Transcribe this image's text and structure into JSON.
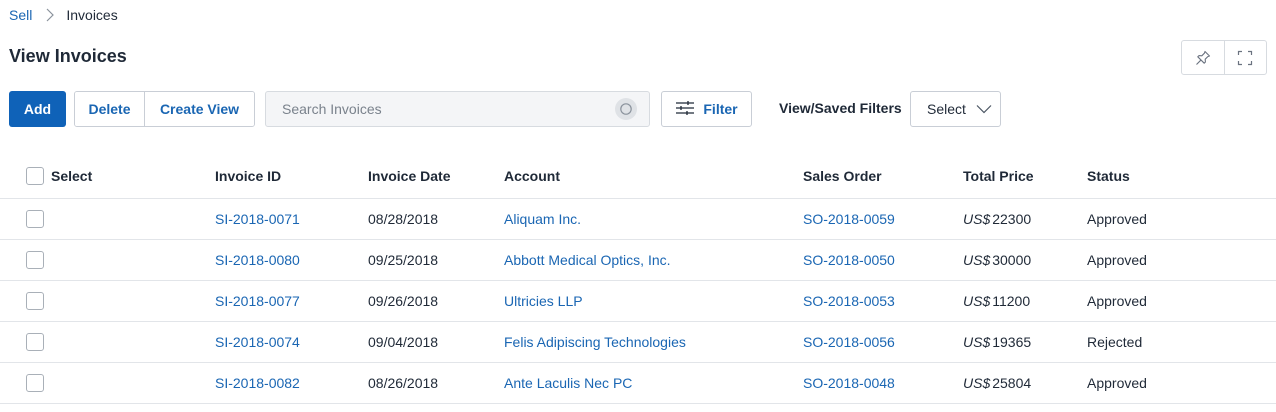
{
  "breadcrumb": {
    "parent": "Sell",
    "current": "Invoices"
  },
  "page": {
    "title": "View Invoices"
  },
  "toolbar": {
    "add_label": "Add",
    "delete_label": "Delete",
    "create_view_label": "Create View",
    "search_placeholder": "Search Invoices",
    "filter_label": "Filter",
    "saved_filters_label": "View/Saved Filters",
    "saved_filters_value": "Select"
  },
  "icons": {
    "breadcrumb_separator": "chevron-right-icon",
    "pin": "pin-icon",
    "expand": "fullscreen-icon",
    "search": "search-icon",
    "filter": "sliders-icon",
    "dropdown": "chevron-down-icon"
  },
  "colors": {
    "primary": "#0f62b8",
    "link": "#1a66b3",
    "border": "#e2e5e9"
  },
  "table": {
    "columns": {
      "select": "Select",
      "invoice_id": "Invoice ID",
      "invoice_date": "Invoice Date",
      "account": "Account",
      "sales_order": "Sales Order",
      "total_price": "Total Price",
      "status": "Status"
    },
    "rows": [
      {
        "invoice_id": "SI-2018-0071",
        "invoice_date": "08/28/2018",
        "account": "Aliquam Inc.",
        "sales_order": "SO-2018-0059",
        "currency": "US$",
        "amount": "22300",
        "status": "Approved"
      },
      {
        "invoice_id": "SI-2018-0080",
        "invoice_date": "09/25/2018",
        "account": "Abbott Medical Optics, Inc.",
        "sales_order": "SO-2018-0050",
        "currency": "US$",
        "amount": "30000",
        "status": "Approved"
      },
      {
        "invoice_id": "SI-2018-0077",
        "invoice_date": "09/26/2018",
        "account": "Ultricies LLP",
        "sales_order": "SO-2018-0053",
        "currency": "US$",
        "amount": "11200",
        "status": "Approved"
      },
      {
        "invoice_id": "SI-2018-0074",
        "invoice_date": "09/04/2018",
        "account": "Felis Adipiscing Technologies",
        "sales_order": "SO-2018-0056",
        "currency": "US$",
        "amount": "19365",
        "status": "Rejected"
      },
      {
        "invoice_id": "SI-2018-0082",
        "invoice_date": "08/26/2018",
        "account": "Ante Laculis Nec PC",
        "sales_order": "SO-2018-0048",
        "currency": "US$",
        "amount": "25804",
        "status": "Approved"
      }
    ]
  }
}
